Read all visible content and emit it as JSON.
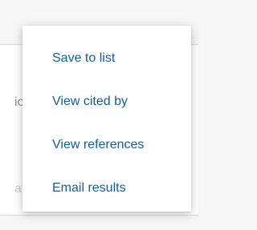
{
  "menu": {
    "items": [
      {
        "label": "Save to list"
      },
      {
        "label": "View cited by"
      },
      {
        "label": "View references"
      },
      {
        "label": "Email results"
      }
    ]
  },
  "background": {
    "partial_text_1": "io",
    "partial_text_2": "at"
  },
  "colors": {
    "link": "#0c5fa8",
    "menu_background": "#ffffff",
    "page_background": "#f6f6f6"
  }
}
